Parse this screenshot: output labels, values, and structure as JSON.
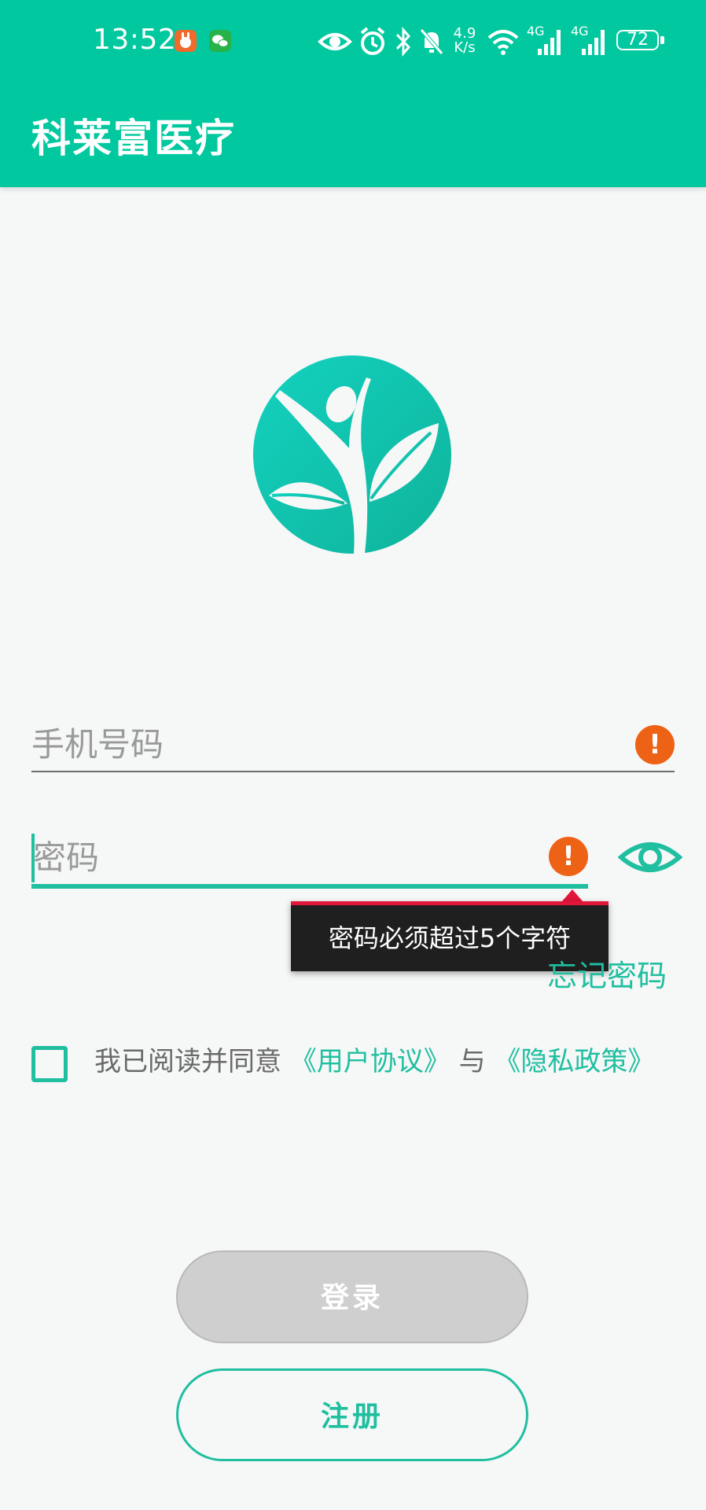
{
  "status_bar": {
    "time": "13:52",
    "network_speed_value": "4.9",
    "network_speed_unit": "K/s",
    "signal1_label": "4G",
    "signal2_label": "4G",
    "battery": "72",
    "icons": [
      "app-notification-icon",
      "wechat-icon",
      "eye-icon",
      "alarm-icon",
      "bluetooth-icon",
      "mute-bell-icon",
      "wifi-icon",
      "signal-icon",
      "signal-icon",
      "battery-icon"
    ]
  },
  "app_bar": {
    "title": "科莱富医疗"
  },
  "logo": {
    "icon": "tree-person-logo-icon",
    "color": "#18c4b3"
  },
  "form": {
    "phone_placeholder": "手机号码",
    "password_placeholder": "密码",
    "error_icon": "error-icon",
    "toggle_icon": "eye-icon"
  },
  "tooltip": {
    "text": "密码必须超过5个字符"
  },
  "forgot_password": "忘记密码",
  "agreement": {
    "prefix": "我已阅读并同意",
    "user_agreement": "《用户协议》",
    "conjunction": "与",
    "privacy_policy": "《隐私政策》",
    "checked": false
  },
  "buttons": {
    "login": "登录",
    "register": "注册"
  },
  "colors": {
    "primary": "#01c89f",
    "accent": "#1fbfa0",
    "error": "#ee6216",
    "tooltip_bar": "#e2163a"
  }
}
